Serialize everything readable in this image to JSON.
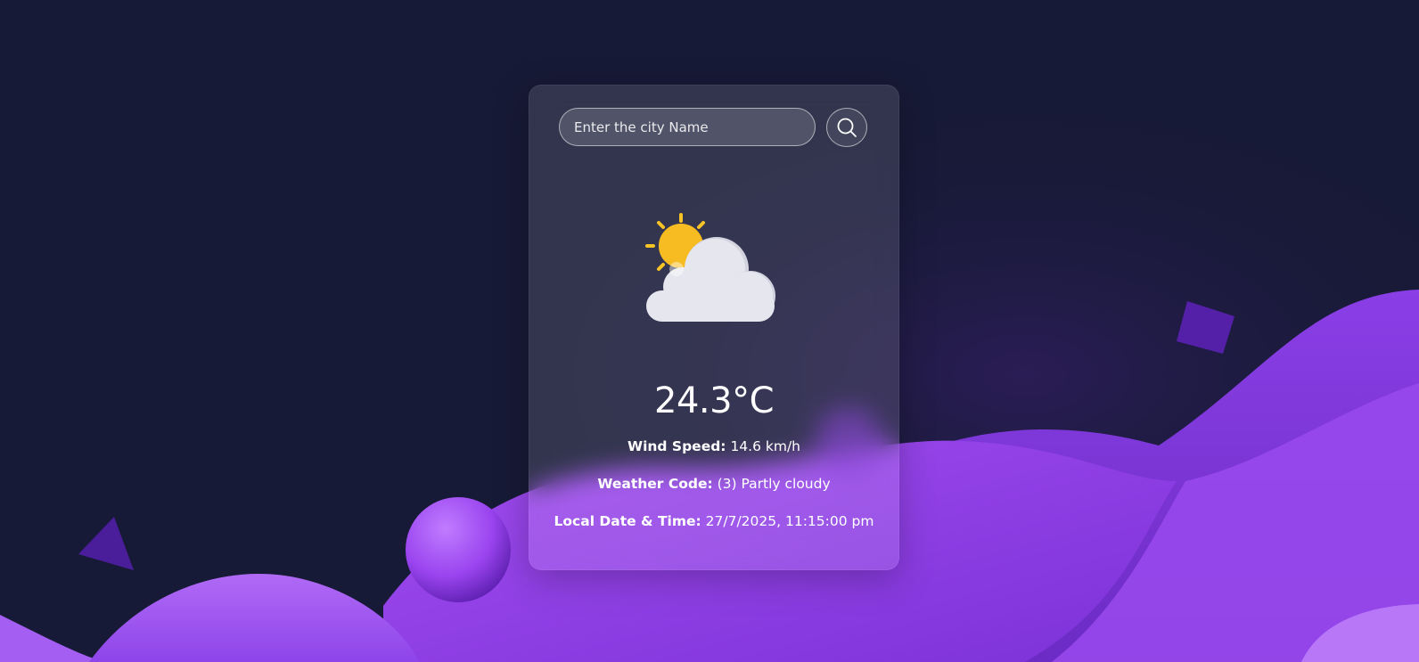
{
  "search": {
    "placeholder": "Enter the city Name",
    "button_icon": "search-icon"
  },
  "weather": {
    "icon": "partly-cloudy-icon",
    "temperature": "24.3°C",
    "wind_speed_label": "Wind Speed:",
    "wind_speed_value": "14.6 km/h",
    "weather_code_label": "Weather Code:",
    "weather_code_value": "(3) Partly cloudy",
    "local_time_label": "Local Date & Time:",
    "local_time_value": "27/7/2025, 11:15:00 pm"
  },
  "colors": {
    "background": "#171a36",
    "accent_purple": "#9b3df0",
    "sun": "#f7c325",
    "cloud": "#e6e7ee"
  }
}
